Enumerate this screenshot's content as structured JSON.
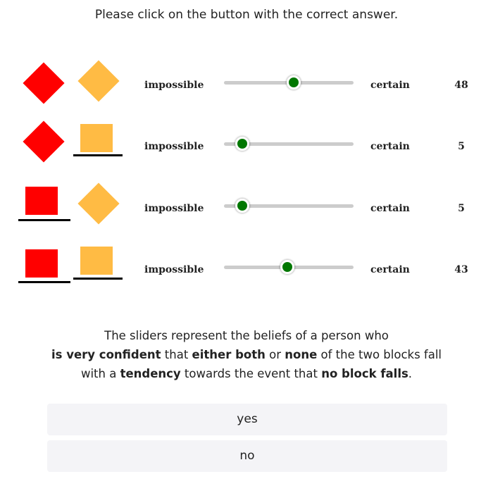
{
  "instruction": "Please click on the button with the correct answer.",
  "scale": {
    "low_label": "impossible",
    "high_label": "certain",
    "min": 0,
    "max": 100
  },
  "colors": {
    "red_block": "#ff0000",
    "orange_block": "#ffbb44",
    "slider_thumb": "#007700",
    "slider_track": "#cccccc",
    "button_bg": "#f4f4f7"
  },
  "rows": [
    {
      "red_block": "tilted",
      "orange_block": "tilted",
      "value": 48,
      "value_label": "48"
    },
    {
      "red_block": "tilted",
      "orange_block": "upright",
      "value": 5,
      "value_label": "5"
    },
    {
      "red_block": "upright",
      "orange_block": "tilted",
      "value": 5,
      "value_label": "5"
    },
    {
      "red_block": "upright",
      "orange_block": "upright",
      "value": 43,
      "value_label": "43"
    }
  ],
  "summary": {
    "line1": "The sliders represent the beliefs of a person who",
    "line2_b1": "is very confident",
    "line2_t1": " that ",
    "line2_b2": "either both",
    "line2_t2": " or ",
    "line2_b3": "none",
    "line2_t3": " of the two blocks fall",
    "line3_t1": "with a ",
    "line3_b1": "tendency",
    "line3_t2": " towards the event that ",
    "line3_b2": "no block falls",
    "line3_t3": "."
  },
  "buttons": {
    "yes_label": "yes",
    "no_label": "no"
  }
}
